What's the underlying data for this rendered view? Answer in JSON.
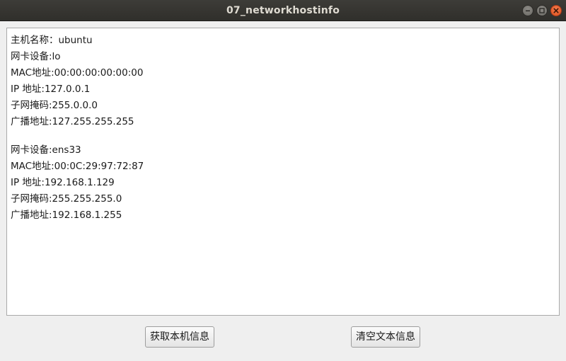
{
  "window": {
    "title": "07_networkhostinfo"
  },
  "output": {
    "lines": [
      "主机名称：ubuntu",
      "网卡设备:lo",
      "MAC地址:00:00:00:00:00:00",
      "IP 地址:127.0.0.1",
      "子网掩码:255.0.0.0",
      "广播地址:127.255.255.255",
      "",
      "网卡设备:ens33",
      "MAC地址:00:0C:29:97:72:87",
      "IP 地址:192.168.1.129",
      "子网掩码:255.255.255.0",
      "广播地址:192.168.1.255"
    ]
  },
  "buttons": {
    "get_info_label": "获取本机信息",
    "clear_text_label": "清空文本信息"
  },
  "icons": {
    "minimize": "minimize-icon",
    "maximize": "maximize-icon",
    "close": "close-icon"
  },
  "colors": {
    "titlebar": "#302f2b",
    "close_button": "#e0531f",
    "window_bg": "#efefef"
  }
}
